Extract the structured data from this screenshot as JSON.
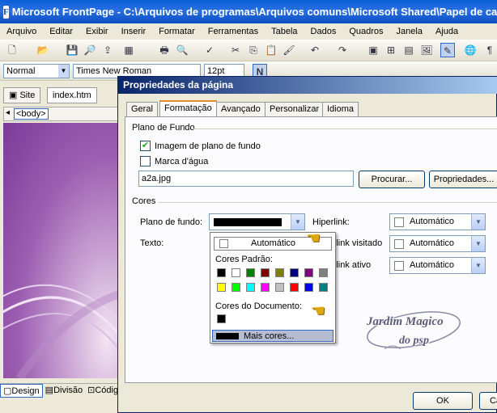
{
  "window": {
    "title": "Microsoft FrontPage - C:\\Arquivos de programas\\Arquivos comuns\\Microsoft Shared\\Papel de ca",
    "app_icon": "frontpage-icon"
  },
  "menu": [
    "Arquivo",
    "Editar",
    "Exibir",
    "Inserir",
    "Formatar",
    "Ferramentas",
    "Tabela",
    "Dados",
    "Quadros",
    "Janela",
    "Ajuda"
  ],
  "format_toolbar": {
    "style_value": "Normal",
    "font_value": "Times New Roman",
    "size_value": "12pt"
  },
  "doc_tabs": {
    "site": "Site",
    "file": "index.htm",
    "tag": "<body>"
  },
  "view_tabs": {
    "design": "Design",
    "split": "Divisão",
    "code": "Códig"
  },
  "dialog": {
    "title": "Propriedades da página",
    "tabs": [
      "Geral",
      "Formatação",
      "Avançado",
      "Personalizar",
      "Idioma"
    ],
    "active_tab": "Formatação",
    "background_group": {
      "label": "Plano de Fundo",
      "bg_image_label": "Imagem de plano de fundo",
      "bg_image_checked": true,
      "watermark_label": "Marca d'água",
      "watermark_checked": false,
      "file_value": "a2a.jpg",
      "browse_label": "Procurar...",
      "properties_label": "Propriedades..."
    },
    "colors_group": {
      "label": "Cores",
      "background_label": "Plano de fundo:",
      "background_color": "#000000",
      "text_label": "Texto:",
      "hyperlink_label": "Hiperlink:",
      "visited_label": "Hiperlink visitado:",
      "active_label": "Hiperlink ativo:",
      "auto_value": "Automático"
    },
    "ok_label": "OK",
    "cancel_label": "Ca"
  },
  "color_popup": {
    "auto_label": "Automático",
    "standard_label": "Cores Padrão:",
    "standard_colors": [
      "#000000",
      "#ffffff",
      "#008000",
      "#800000",
      "#808000",
      "#000080",
      "#800080",
      "#808080",
      "#ffff00",
      "#00ff00",
      "#00ffff",
      "#ff00ff",
      "#c0c0c0",
      "#ff0000",
      "#0000ff",
      "#008080"
    ],
    "document_label": "Cores do Documento:",
    "document_colors": [
      "#000000"
    ],
    "more_label": "Mais cores..."
  },
  "watermark_signature": {
    "line1": "Jardim Magico",
    "line2": "do psp"
  }
}
